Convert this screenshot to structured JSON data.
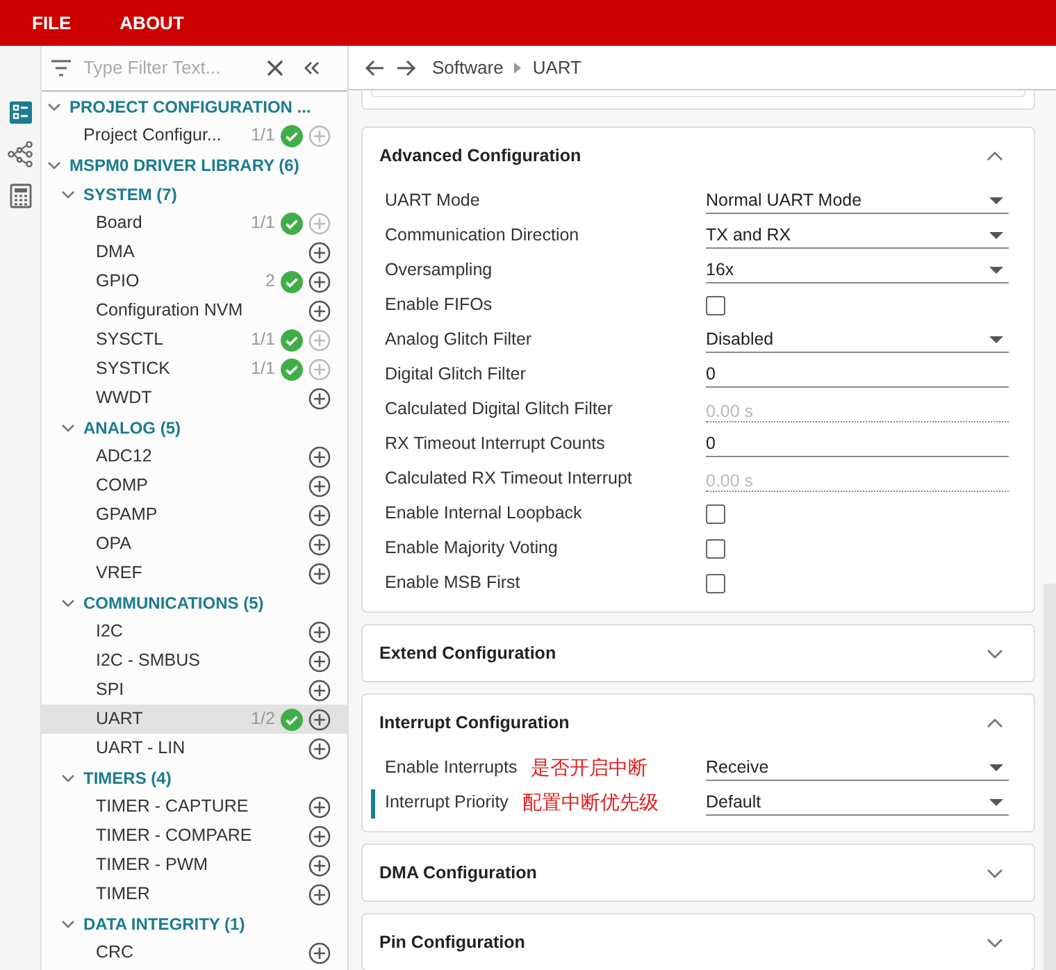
{
  "menu": [
    {
      "label": "FILE"
    },
    {
      "label": "ABOUT"
    }
  ],
  "rail": [
    {
      "kind": "config",
      "selected": true
    },
    {
      "kind": "tree",
      "selected": false
    },
    {
      "kind": "calc",
      "selected": false
    }
  ],
  "filter": {
    "placeholder": "Type Filter Text..."
  },
  "tree": [
    {
      "label": "PROJECT CONFIGURATION ...",
      "expanded": true,
      "children": [
        {
          "label": "Project Configur...",
          "count": "1/1",
          "ok": true,
          "add_enabled": false,
          "selected": false
        }
      ]
    },
    {
      "label": "MSPM0 DRIVER LIBRARY (6)",
      "expanded": true,
      "children": [
        {
          "label": "SYSTEM (7)",
          "expanded": true,
          "children": [
            {
              "label": "Board",
              "count": "1/1",
              "ok": true,
              "add_enabled": false,
              "selected": false
            },
            {
              "label": "DMA",
              "ok": false,
              "add_enabled": true,
              "selected": false
            },
            {
              "label": "GPIO",
              "count": "2",
              "ok": true,
              "add_enabled": true,
              "selected": false
            },
            {
              "label": "Configuration NVM",
              "ok": false,
              "add_enabled": true,
              "selected": false
            },
            {
              "label": "SYSCTL",
              "count": "1/1",
              "ok": true,
              "add_enabled": false,
              "selected": false
            },
            {
              "label": "SYSTICK",
              "count": "1/1",
              "ok": true,
              "add_enabled": false,
              "selected": false
            },
            {
              "label": "WWDT",
              "ok": false,
              "add_enabled": true,
              "selected": false
            }
          ]
        },
        {
          "label": "ANALOG (5)",
          "expanded": true,
          "children": [
            {
              "label": "ADC12",
              "ok": false,
              "add_enabled": true,
              "selected": false
            },
            {
              "label": "COMP",
              "ok": false,
              "add_enabled": true,
              "selected": false
            },
            {
              "label": "GPAMP",
              "ok": false,
              "add_enabled": true,
              "selected": false
            },
            {
              "label": "OPA",
              "ok": false,
              "add_enabled": true,
              "selected": false
            },
            {
              "label": "VREF",
              "ok": false,
              "add_enabled": true,
              "selected": false
            }
          ]
        },
        {
          "label": "COMMUNICATIONS (5)",
          "expanded": true,
          "children": [
            {
              "label": "I2C",
              "ok": false,
              "add_enabled": true,
              "selected": false
            },
            {
              "label": "I2C - SMBUS",
              "ok": false,
              "add_enabled": true,
              "selected": false
            },
            {
              "label": "SPI",
              "ok": false,
              "add_enabled": true,
              "selected": false
            },
            {
              "label": "UART",
              "count": "1/2",
              "ok": true,
              "add_enabled": true,
              "selected": true
            },
            {
              "label": "UART - LIN",
              "ok": false,
              "add_enabled": true,
              "selected": false
            }
          ]
        },
        {
          "label": "TIMERS (4)",
          "expanded": true,
          "children": [
            {
              "label": "TIMER - CAPTURE",
              "ok": false,
              "add_enabled": true,
              "selected": false
            },
            {
              "label": "TIMER - COMPARE",
              "ok": false,
              "add_enabled": true,
              "selected": false
            },
            {
              "label": "TIMER - PWM",
              "ok": false,
              "add_enabled": true,
              "selected": false
            },
            {
              "label": "TIMER",
              "ok": false,
              "add_enabled": true,
              "selected": false
            }
          ]
        },
        {
          "label": "DATA INTEGRITY (1)",
          "expanded": true,
          "children": [
            {
              "label": "CRC",
              "ok": false,
              "add_enabled": true,
              "selected": false
            }
          ]
        }
      ]
    }
  ],
  "breadcrumb": [
    "Software",
    "UART"
  ],
  "sections": [
    {
      "title": "Advanced Configuration",
      "expanded": true,
      "rows": [
        {
          "label": "UART Mode",
          "kind": "select",
          "value": "Normal UART Mode"
        },
        {
          "label": "Communication Direction",
          "kind": "select",
          "value": "TX and RX"
        },
        {
          "label": "Oversampling",
          "kind": "select",
          "value": "16x"
        },
        {
          "label": "Enable FIFOs",
          "kind": "checkbox",
          "checked": false
        },
        {
          "label": "Analog Glitch Filter",
          "kind": "select",
          "value": "Disabled"
        },
        {
          "label": "Digital Glitch Filter",
          "kind": "input",
          "value": "0"
        },
        {
          "label": "Calculated Digital Glitch Filter",
          "kind": "readonly",
          "value": "0.00 s"
        },
        {
          "label": "RX Timeout Interrupt Counts",
          "kind": "input",
          "value": "0"
        },
        {
          "label": "Calculated RX Timeout Interrupt",
          "kind": "readonly",
          "value": "0.00 s"
        },
        {
          "label": "Enable Internal Loopback",
          "kind": "checkbox",
          "checked": false
        },
        {
          "label": "Enable Majority Voting",
          "kind": "checkbox",
          "checked": false
        },
        {
          "label": "Enable MSB First",
          "kind": "checkbox",
          "checked": false
        }
      ]
    },
    {
      "title": "Extend Configuration",
      "expanded": false
    },
    {
      "title": "Interrupt Configuration",
      "expanded": true,
      "rows": [
        {
          "label": "Enable Interrupts",
          "annotation": "是否开启中断",
          "kind": "select",
          "value": "Receive",
          "focused": false
        },
        {
          "label": "Interrupt Priority",
          "annotation": "配置中断优先级",
          "kind": "select",
          "value": "Default",
          "focused": true
        }
      ]
    },
    {
      "title": "DMA Configuration",
      "expanded": false
    },
    {
      "title": "Pin Configuration",
      "expanded": false
    }
  ]
}
